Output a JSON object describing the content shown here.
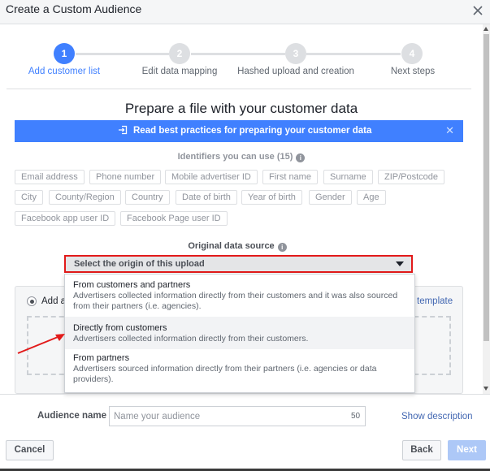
{
  "dialog": {
    "title": "Create a Custom Audience"
  },
  "stepper": {
    "steps": [
      {
        "number": "1",
        "label": "Add customer list",
        "active": true
      },
      {
        "number": "2",
        "label": "Edit data mapping",
        "active": false
      },
      {
        "number": "3",
        "label": "Hashed upload and creation",
        "active": false
      },
      {
        "number": "4",
        "label": "Next steps",
        "active": false
      }
    ]
  },
  "main": {
    "heading": "Prepare a file with your customer data",
    "banner": {
      "text": "Read best practices for preparing your customer data",
      "close_glyph": "✕"
    },
    "identifiers": {
      "heading": "Identifiers you can use (15)",
      "info_glyph": "i",
      "items": [
        "Email address",
        "Phone number",
        "Mobile advertiser ID",
        "First name",
        "Surname",
        "ZIP/Postcode",
        "City",
        "County/Region",
        "Country",
        "Date of birth",
        "Year of birth",
        "Gender",
        "Age",
        "Facebook app user ID",
        "Facebook Page user ID"
      ]
    },
    "data_source": {
      "label": "Original data source",
      "info_glyph": "i",
      "select_value": "Select the origin of this upload",
      "options": [
        {
          "title": "From customers and partners",
          "description": "Advertisers collected information directly from their customers and it was also sourced from their partners (i.e. agencies)."
        },
        {
          "title": "Directly from customers",
          "description": "Advertisers collected information directly from their customers."
        },
        {
          "title": "From partners",
          "description": "Advertisers sourced information directly from their partners (i.e. agencies or data providers)."
        }
      ]
    },
    "upload": {
      "radio_label": "Add a",
      "link_text": "template"
    }
  },
  "footer": {
    "audience_name_label": "Audience name",
    "audience_name_placeholder": "Name your audience",
    "audience_name_value": "",
    "char_count": "50",
    "show_description": "Show description",
    "cancel_label": "Cancel",
    "back_label": "Back",
    "next_label": "Next"
  },
  "colors": {
    "accent": "#4080ff",
    "highlight_border": "#e21a1a",
    "link": "#4267b2"
  }
}
